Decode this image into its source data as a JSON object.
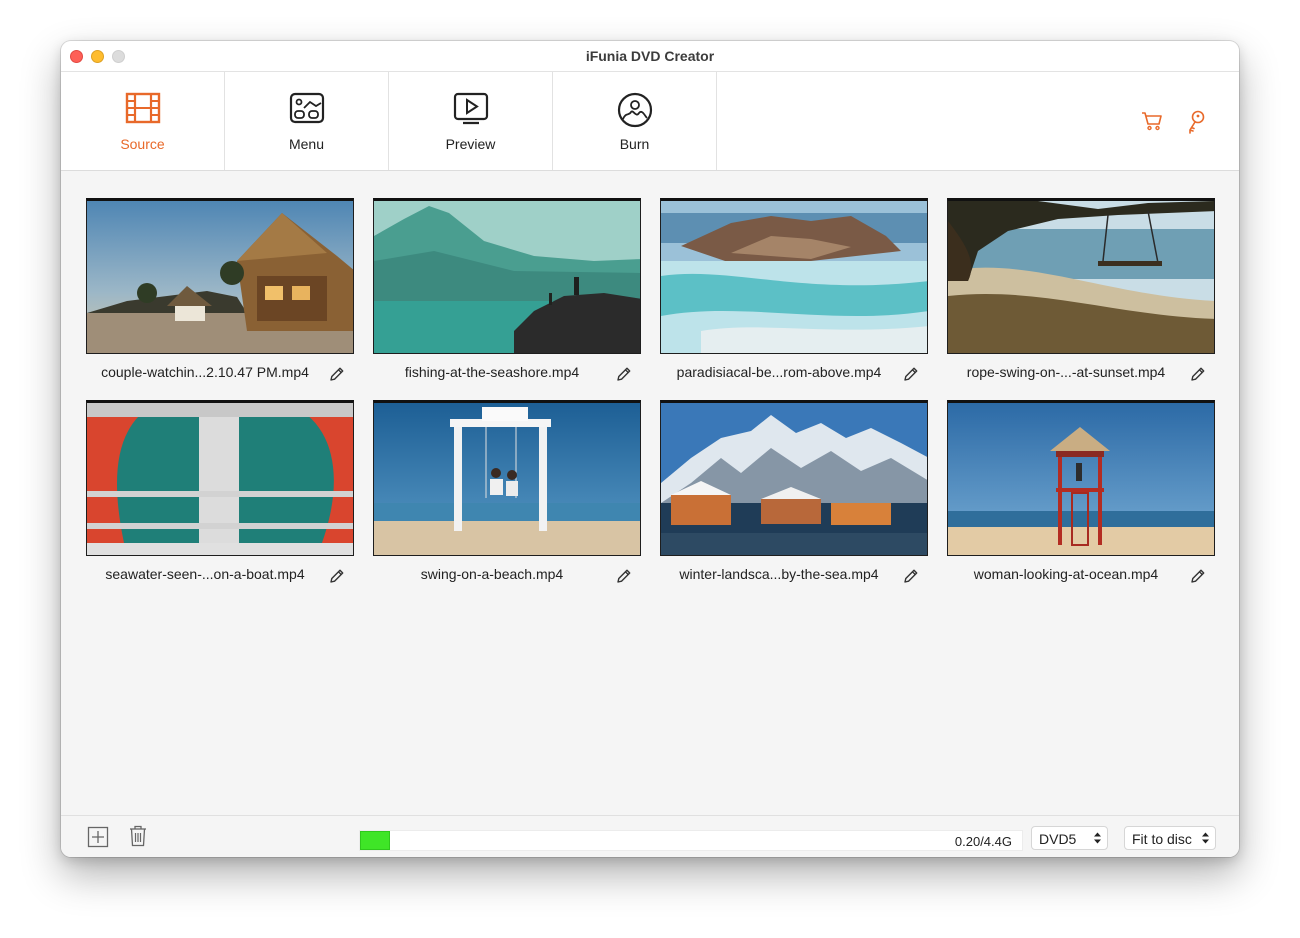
{
  "window": {
    "title": "iFunia DVD Creator"
  },
  "toolbar": {
    "tabs": [
      {
        "label": "Source",
        "active": true
      },
      {
        "label": "Menu",
        "active": false
      },
      {
        "label": "Preview",
        "active": false
      },
      {
        "label": "Burn",
        "active": false
      }
    ],
    "accent_color": "#e8692a"
  },
  "clips": [
    {
      "filename": "couple-watchin...2.10.47 PM.mp4"
    },
    {
      "filename": "fishing-at-the-seashore.mp4"
    },
    {
      "filename": "paradisiacal-be...rom-above.mp4"
    },
    {
      "filename": "rope-swing-on-...-at-sunset.mp4"
    },
    {
      "filename": "seawater-seen-...on-a-boat.mp4"
    },
    {
      "filename": "swing-on-a-beach.mp4"
    },
    {
      "filename": "winter-landsca...by-the-sea.mp4"
    },
    {
      "filename": "woman-looking-at-ocean.mp4"
    }
  ],
  "bottom": {
    "usage_text": "0.20/4.4G",
    "usage_fraction": 0.045,
    "disc_type": "DVD5",
    "fit_mode": "Fit to disc",
    "fill_color": "#3fe527"
  }
}
